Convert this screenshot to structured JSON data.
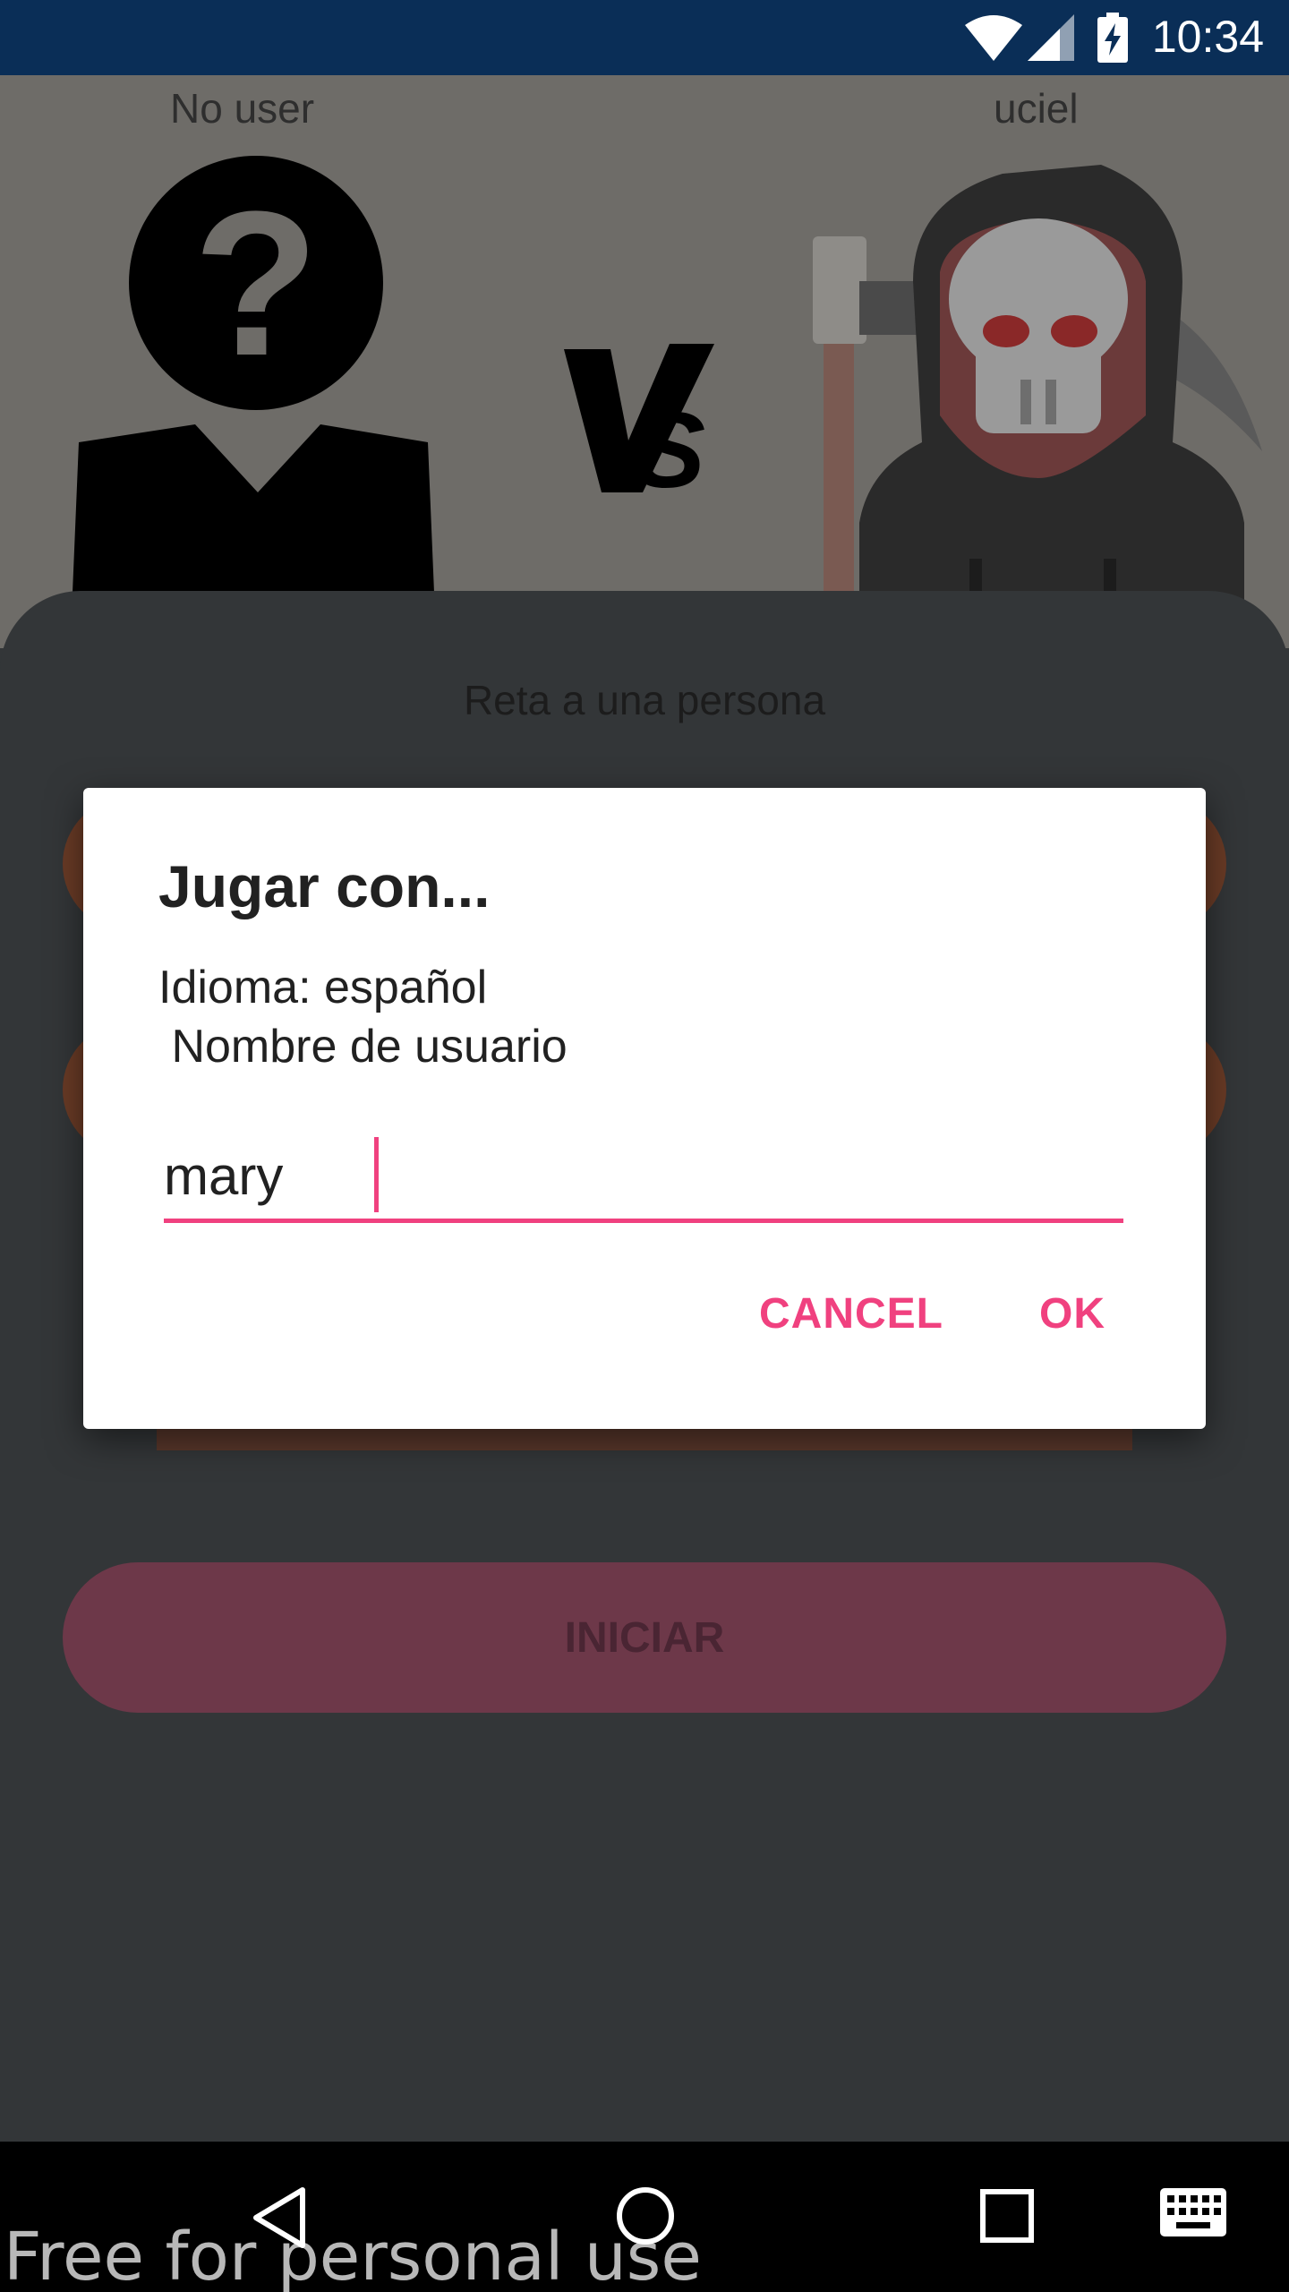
{
  "status_bar": {
    "time": "10:34",
    "icons": [
      "wifi-icon",
      "signal-icon",
      "battery-charging-icon"
    ]
  },
  "match": {
    "player1_name": "No user",
    "player2_name": "uciel",
    "player1_avatar": "unknown-user-icon",
    "player2_avatar": "grim-reaper-icon",
    "vs_label": "VS"
  },
  "panel": {
    "heading": "Reta a una persona",
    "start_button": "INICIAR"
  },
  "dialog": {
    "title": "Jugar con...",
    "message": "Idioma: español\n Nombre de usuario",
    "input_value": "mary",
    "cancel_label": "CANCEL",
    "ok_label": "OK"
  },
  "nav_bar": {
    "icons": [
      "back-icon",
      "home-icon",
      "recents-icon",
      "keyboard-icon"
    ]
  },
  "watermark": "Free for personal use",
  "colors": {
    "status_bar": "#0a2e57",
    "accent": "#f0417f",
    "panel": "#333638",
    "start_button": "#6d3849"
  }
}
